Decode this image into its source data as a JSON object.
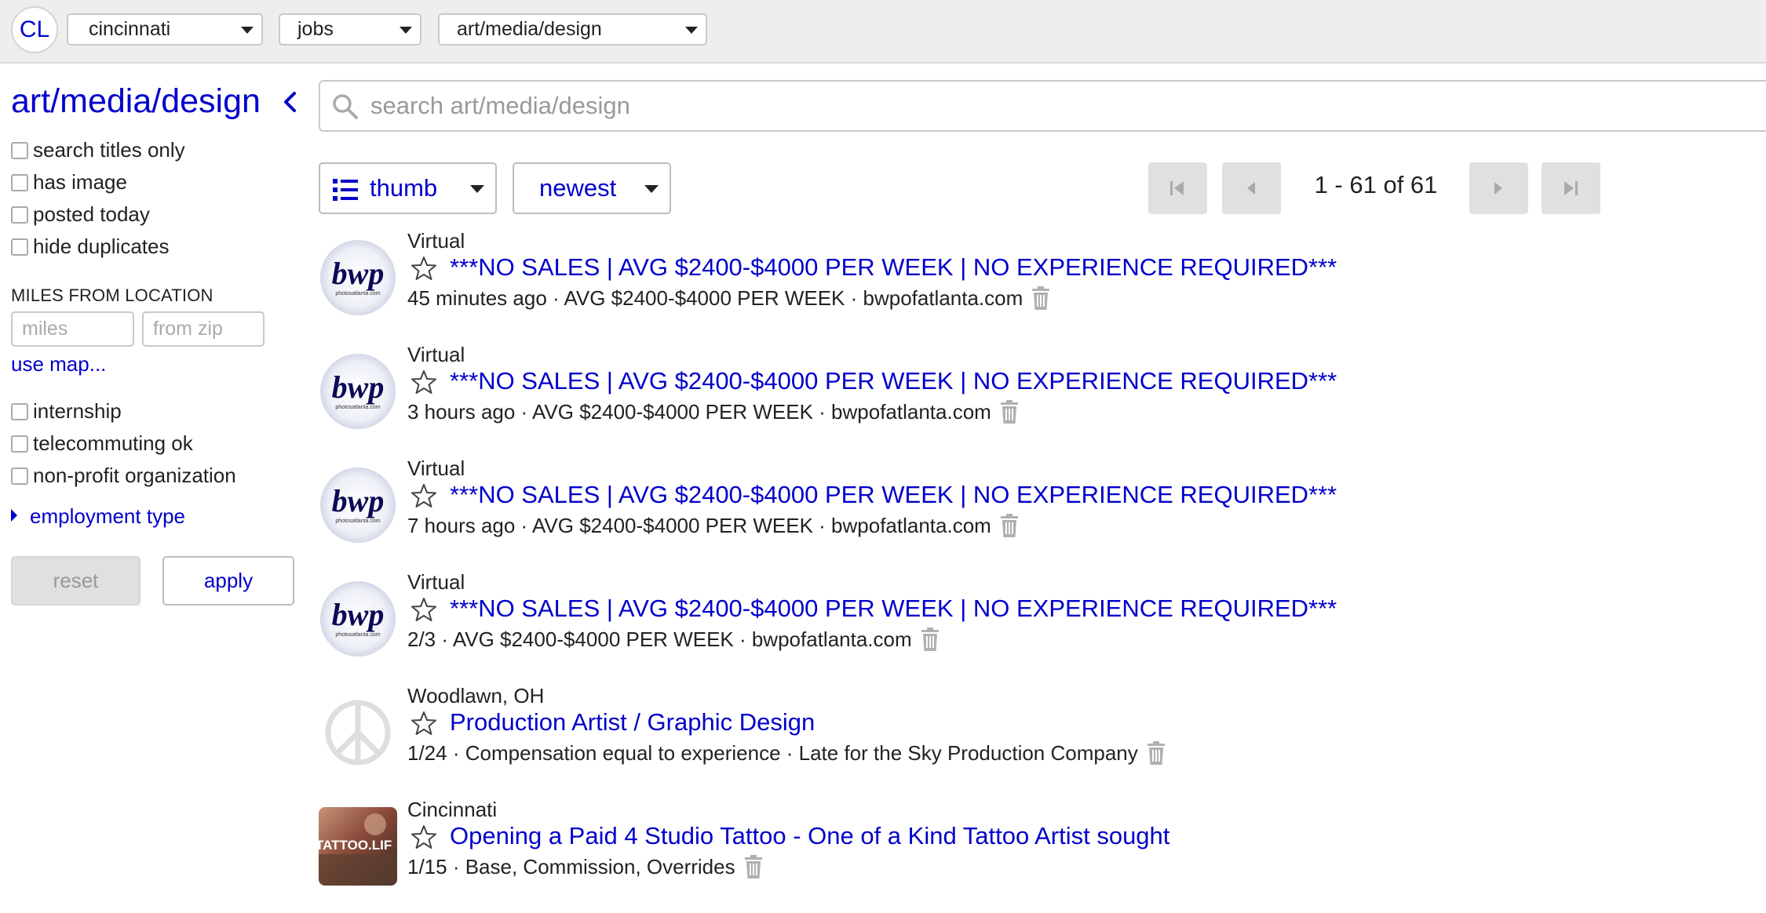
{
  "header": {
    "logo": "CL",
    "area": "cincinnati",
    "category": "jobs",
    "subcategory": "art/media/design"
  },
  "sidebar": {
    "title": "art/media/design",
    "filters": [
      {
        "label": "search titles only",
        "checked": false
      },
      {
        "label": "has image",
        "checked": false
      },
      {
        "label": "posted today",
        "checked": false
      },
      {
        "label": "hide duplicates",
        "checked": false
      }
    ],
    "miles_label": "MILES FROM LOCATION",
    "miles_placeholder": "miles",
    "zip_placeholder": "from zip",
    "use_map": "use map...",
    "job_filters": [
      {
        "label": "internship",
        "checked": false
      },
      {
        "label": "telecommuting ok",
        "checked": false
      },
      {
        "label": "non-profit organization",
        "checked": false
      }
    ],
    "employment_type": "employment type",
    "reset_label": "reset",
    "apply_label": "apply"
  },
  "search": {
    "placeholder": "search art/media/design"
  },
  "toolbar": {
    "view_label": "thumb",
    "sort_label": "newest",
    "range": "1 - 61 of 61"
  },
  "results": [
    {
      "location": "Virtual",
      "title": "***NO SALES | AVG $2400-$4000 PER WEEK | NO EXPERIENCE REQUIRED***",
      "meta": "45 minutes ago  · AVG $2400-$4000 PER WEEK · bwpofatlanta.com",
      "thumb": "bwp"
    },
    {
      "location": "Virtual",
      "title": "***NO SALES | AVG $2400-$4000 PER WEEK | NO EXPERIENCE REQUIRED***",
      "meta": "3 hours ago  · AVG $2400-$4000 PER WEEK · bwpofatlanta.com",
      "thumb": "bwp"
    },
    {
      "location": "Virtual",
      "title": "***NO SALES | AVG $2400-$4000 PER WEEK | NO EXPERIENCE REQUIRED***",
      "meta": "7 hours ago  · AVG $2400-$4000 PER WEEK · bwpofatlanta.com",
      "thumb": "bwp"
    },
    {
      "location": "Virtual",
      "title": "***NO SALES | AVG $2400-$4000 PER WEEK | NO EXPERIENCE REQUIRED***",
      "meta": "2/3  · AVG $2400-$4000 PER WEEK · bwpofatlanta.com",
      "thumb": "bwp"
    },
    {
      "location": "Woodlawn, OH",
      "title": "Production Artist / Graphic Design",
      "meta": "1/24  · Compensation equal to experience · Late for the Sky Production Company",
      "thumb": "peace"
    },
    {
      "location": "Cincinnati",
      "title": "Opening a Paid 4 Studio Tattoo - One of a Kind Tattoo Artist sought",
      "meta": "1/15  · Base, Commission, Overrides",
      "thumb": "tattoo"
    }
  ],
  "thumb_text": {
    "bwp": "bwp",
    "bwp_sub": "photosatlanta.com",
    "tattoo": "TATTOO.LIF"
  },
  "colors": {
    "link": "#0000cc",
    "topbar": "#eeeeee",
    "disabled": "#e0e0e0",
    "trash": "#b0b0b0"
  }
}
